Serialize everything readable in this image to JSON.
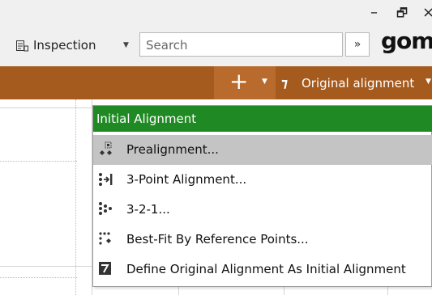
{
  "window": {
    "minimize_glyph": "–",
    "restore_glyph": "🗗",
    "close_glyph": "×"
  },
  "toolbar": {
    "workspace_label": "Inspection",
    "workspace_caret": "▼",
    "search_placeholder": "Search",
    "search_chevron": "»",
    "brand": "gom"
  },
  "ribbon": {
    "add_glyph": "+",
    "add_caret": "▼",
    "alignment_icon": "⁊",
    "alignment_label": "Original alignment",
    "alignment_caret": "▼",
    "colors": {
      "ribbon": "#a55a1e",
      "active": "#b86b2c"
    }
  },
  "menu": {
    "header": "Initial Alignment",
    "header_color": "#1f8a24",
    "items": [
      {
        "label": "Prealignment...",
        "icon": "prealignment-icon",
        "highlighted": true
      },
      {
        "label": "3-Point Alignment...",
        "icon": "three-point-alignment-icon",
        "highlighted": false
      },
      {
        "label": "3-2-1...",
        "icon": "three-two-one-icon",
        "highlighted": false
      },
      {
        "label": "Best-Fit By Reference Points...",
        "icon": "best-fit-reference-points-icon",
        "highlighted": false
      },
      {
        "label": "Define Original Alignment As Initial Alignment",
        "icon": "define-original-alignment-icon",
        "highlighted": false
      }
    ]
  }
}
